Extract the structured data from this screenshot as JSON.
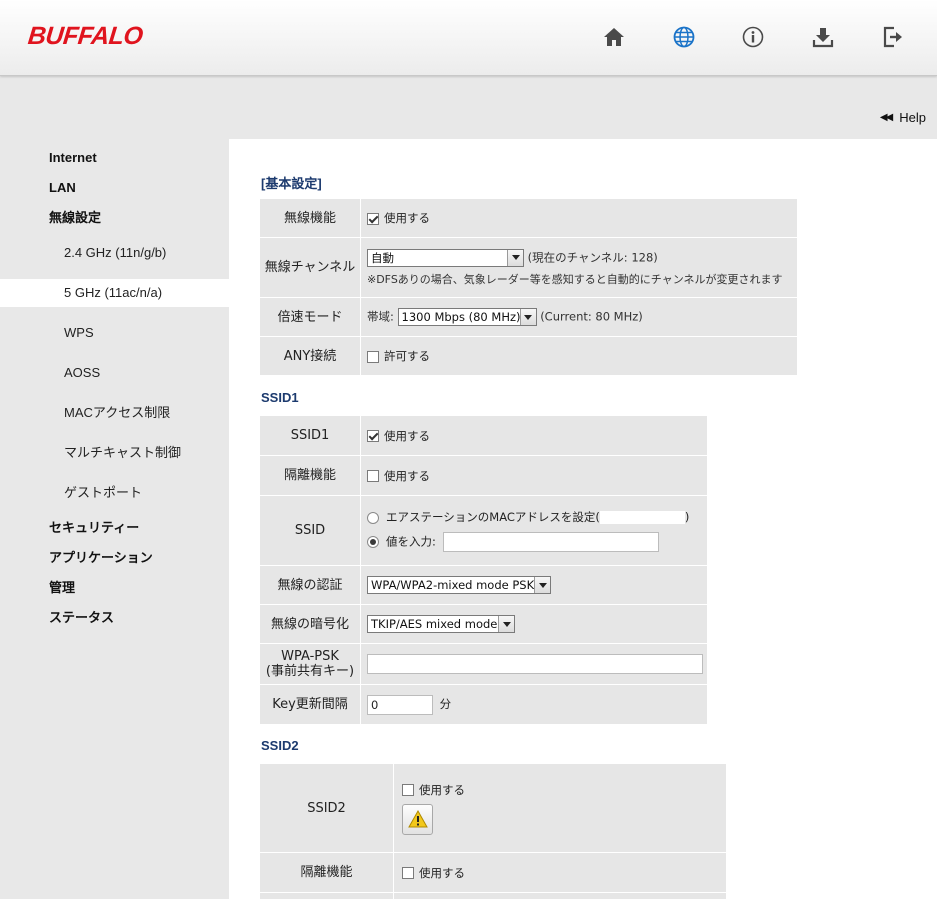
{
  "brand": {
    "logo": "BUFFALO"
  },
  "nav": {
    "icons": [
      "home-icon",
      "globe-icon",
      "info-icon",
      "download-icon",
      "logout-icon"
    ],
    "accent_color": "#1a73c8"
  },
  "help": {
    "label": "Help"
  },
  "sidebar": {
    "items": [
      {
        "label": "Internet",
        "level": "main"
      },
      {
        "label": "LAN",
        "level": "main"
      },
      {
        "label": "無線設定",
        "level": "main"
      },
      {
        "label": "2.4 GHz (11n/g/b)",
        "level": "sub"
      },
      {
        "label": "5 GHz (11ac/n/a)",
        "level": "sub",
        "active": true
      },
      {
        "label": "WPS",
        "level": "sub"
      },
      {
        "label": "AOSS",
        "level": "sub"
      },
      {
        "label": "MACアクセス制限",
        "level": "sub"
      },
      {
        "label": "マルチキャスト制御",
        "level": "sub"
      },
      {
        "label": "ゲストポート",
        "level": "sub"
      },
      {
        "label": "セキュリティー",
        "level": "main"
      },
      {
        "label": "アプリケーション",
        "level": "main"
      },
      {
        "label": "管理",
        "level": "main"
      },
      {
        "label": "ステータス",
        "level": "main"
      }
    ]
  },
  "basic": {
    "title": "[基本設定]",
    "wireless_label": "無線機能",
    "wireless_use": "使用する",
    "channel_label": "無線チャンネル",
    "channel_value": "自動",
    "channel_current": "(現在のチャンネル: 128)",
    "channel_note": "※DFSありの場合、気象レーダー等を感知すると自動的にチャンネルが変更されます",
    "speed_label": "倍速モード",
    "speed_band_label": "帯域:",
    "speed_value": "1300 Mbps (80 MHz)",
    "speed_current": "(Current: 80 MHz)",
    "any_label": "ANY接続",
    "any_allow": "許可する"
  },
  "ssid1": {
    "title": "SSID1",
    "ssid1_label": "SSID1",
    "ssid1_use": "使用する",
    "isolation_label": "隔離機能",
    "isolation_use": "使用する",
    "ssid_label": "SSID",
    "ssid_mac_option": "エアステーションのMACアドレスを設定(",
    "ssid_mac_close": ")",
    "ssid_value_option": "値を入力:",
    "ssid_value": "",
    "auth_label": "無線の認証",
    "auth_value": "WPA/WPA2-mixed mode PSK",
    "enc_label": "無線の暗号化",
    "enc_value": "TKIP/AES mixed mode",
    "psk_label_1": "WPA-PSK",
    "psk_label_2": "(事前共有キー)",
    "psk_value": "",
    "key_interval_label": "Key更新間隔",
    "key_interval_value": "0",
    "key_interval_unit": "分"
  },
  "ssid2": {
    "title": "SSID2",
    "ssid2_label": "SSID2",
    "ssid2_use": "使用する",
    "isolation_label": "隔離機能",
    "isolation_use": "使用する"
  }
}
